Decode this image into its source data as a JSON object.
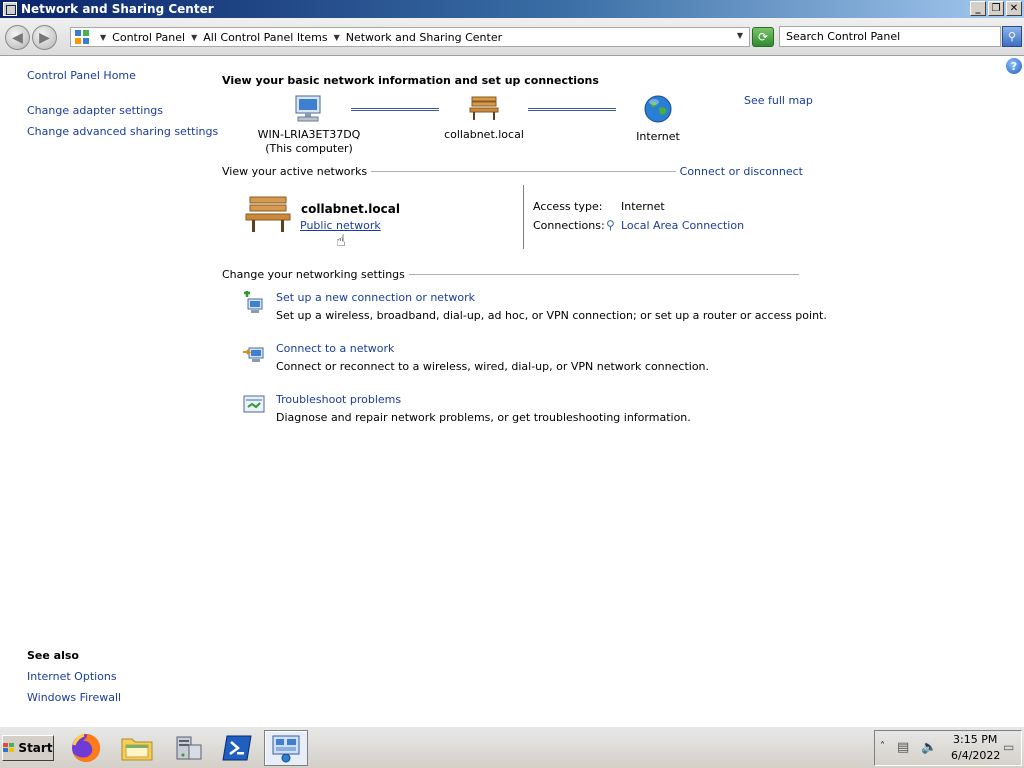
{
  "window": {
    "title": "Network and Sharing Center"
  },
  "address_bar": {
    "breadcrumbs": [
      "Control Panel",
      "All Control Panel Items",
      "Network and Sharing Center"
    ],
    "search_placeholder": "Search Control Panel"
  },
  "left_pane": {
    "items": [
      "Control Panel Home",
      "Change adapter settings",
      "Change advanced sharing settings"
    ],
    "see_also_title": "See also",
    "see_also_items": [
      "Internet Options",
      "Windows Firewall"
    ]
  },
  "main": {
    "heading": "View your basic network information and set up connections",
    "network_map": {
      "computer_name": "WIN-LRIA3ET37DQ",
      "computer_sub": "(This computer)",
      "network_name": "collabnet.local",
      "internet_label": "Internet",
      "see_full_map": "See full map"
    },
    "active_networks": {
      "title": "View your active networks",
      "connect_link": "Connect or disconnect",
      "network_name": "collabnet.local",
      "network_type": "Public network",
      "access_type_label": "Access type:",
      "access_type_value": "Internet",
      "connections_label": "Connections:",
      "connections_value": "Local Area Connection"
    },
    "settings": {
      "title": "Change your networking settings",
      "tasks": [
        {
          "title": "Set up a new connection or network",
          "desc": "Set up a wireless, broadband, dial-up, ad hoc, or VPN connection; or set up a router or access point."
        },
        {
          "title": "Connect to a network",
          "desc": "Connect or reconnect to a wireless, wired, dial-up, or VPN network connection."
        },
        {
          "title": "Troubleshoot problems",
          "desc": "Diagnose and repair network problems, or get troubleshooting information."
        }
      ]
    }
  },
  "taskbar": {
    "start_label": "Start",
    "apps": [
      "firefox-icon",
      "folder-icon",
      "server-manager-icon",
      "powershell-icon",
      "network-center-icon"
    ],
    "clock_time": "3:15 PM",
    "clock_date": "6/4/2022"
  }
}
